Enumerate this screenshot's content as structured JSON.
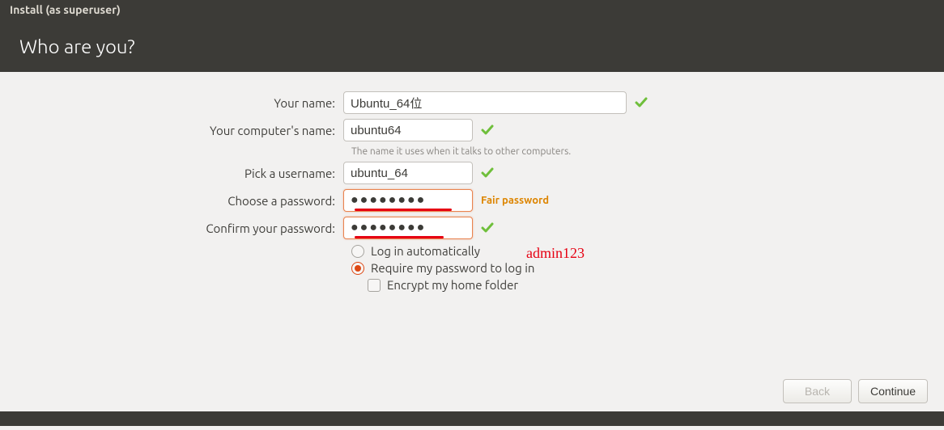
{
  "window": {
    "title": "Install (as superuser)",
    "heading": "Who are you?"
  },
  "form": {
    "your_name": {
      "label": "Your name:",
      "value": "Ubuntu_64位"
    },
    "computer_name": {
      "label": "Your computer's name:",
      "value": "ubuntu64",
      "hint": "The name it uses when it talks to other computers."
    },
    "username": {
      "label": "Pick a username:",
      "value": "ubuntu_64"
    },
    "password": {
      "label": "Choose a password:",
      "value": "●●●●●●●●",
      "strength": "Fair password"
    },
    "confirm": {
      "label": "Confirm your password:",
      "value": "●●●●●●●●"
    },
    "radio_auto": "Log in automatically",
    "radio_require": "Require my password to log in",
    "check_encrypt": "Encrypt my home folder"
  },
  "annotation": {
    "text": "admin123"
  },
  "buttons": {
    "back": "Back",
    "continue": "Continue"
  }
}
